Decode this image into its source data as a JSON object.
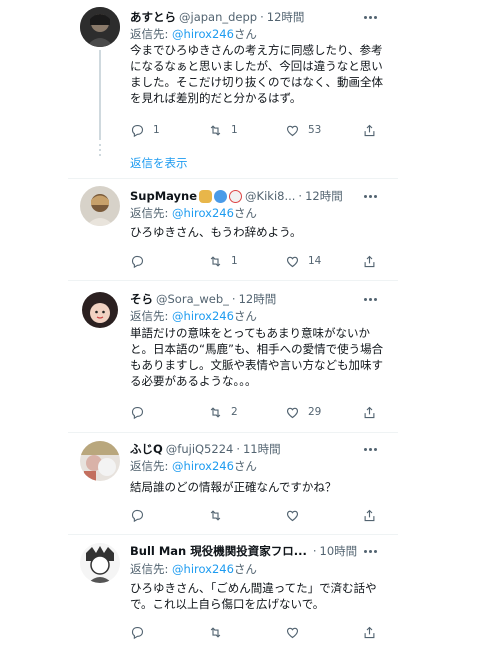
{
  "tweets": [
    {
      "name": "あすとら",
      "handle": "@japan_depp",
      "time": "12時間",
      "reply_prefix": "返信先: ",
      "reply_mention": "@hirox246",
      "reply_suffix": "さん",
      "text": "今までひろゆきさんの考え方に同感したり、参考になるなぁと思いましたが、今回は違うなと思いました。そこだけ切り抜くのではなく、動画全体を見れば差別的だと分かるはず。",
      "replies": "1",
      "retweets": "1",
      "likes": "53"
    },
    {
      "name": "SupMayne",
      "handle": "@Kiki8...",
      "time": "12時間",
      "reply_prefix": "返信先: ",
      "reply_mention": "@hirox246",
      "reply_suffix": "さん",
      "text": "ひろゆきさん、もうわ辞めよう。",
      "replies": "",
      "retweets": "1",
      "likes": "14"
    },
    {
      "name": "そら",
      "handle": "@Sora_web_",
      "time": "12時間",
      "reply_prefix": "返信先: ",
      "reply_mention": "@hirox246",
      "reply_suffix": "さん",
      "text": "単語だけの意味をとってもあまり意味がないかと。日本語の“馬鹿”も、相手への愛情で使う場合もありますし。文脈や表情や言い方なども加味する必要があるような。。。",
      "replies": "",
      "retweets": "2",
      "likes": "29"
    },
    {
      "name": "ふじQ",
      "handle": "@fujiQ5224",
      "time": "11時間",
      "reply_prefix": "返信先: ",
      "reply_mention": "@hirox246",
      "reply_suffix": "さん",
      "text": "結局誰のどの情報が正確なんですかね？",
      "replies": "",
      "retweets": "",
      "likes": ""
    },
    {
      "name": "Bull Man 現役機関投資家フロ...",
      "handle": "",
      "time": "10時間",
      "reply_prefix": "返信先: ",
      "reply_mention": "@hirox246",
      "reply_suffix": "さん",
      "text": "ひろゆきさん、「ごめん間違ってた」で済む話やで。これ以上自ら傷口を広げないで。",
      "replies": "",
      "retweets": "",
      "likes": ""
    }
  ],
  "show_replies_label": "返信を表示",
  "dot_separator": "·",
  "icons": {
    "reply": "reply-icon",
    "retweet": "retweet-icon",
    "like": "heart-icon",
    "share": "share-icon",
    "more": "more-icon"
  },
  "colors": {
    "link": "#1d9bf0",
    "muted": "#536471",
    "text": "#0f1419",
    "divider": "#eff3f4"
  }
}
